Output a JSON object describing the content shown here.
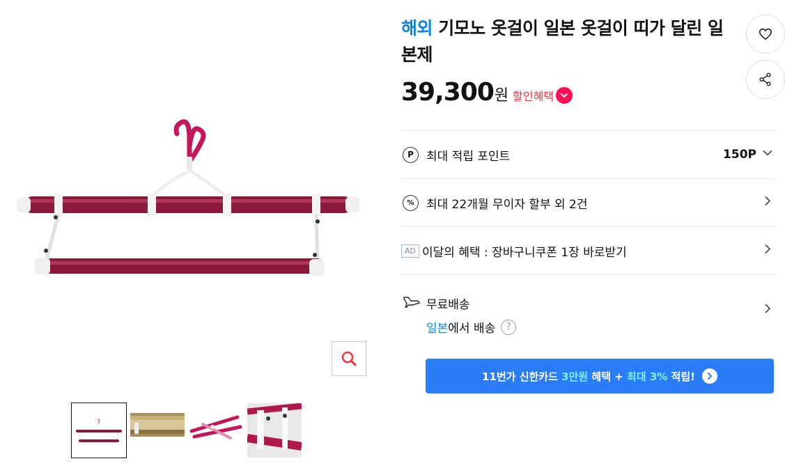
{
  "product": {
    "badge": "해외",
    "title": "기모노 옷걸이 일본 옷걸이 띠가 달린 일본제",
    "price": "39,300",
    "currency": "원",
    "discount_label": "할인혜택"
  },
  "actions": {
    "wish_icon": "heart-icon",
    "share_icon": "share-icon",
    "zoom_icon": "zoom-icon"
  },
  "benefits": {
    "points_label": "최대 적립 포인트",
    "points_value": "150P",
    "installment_label": "최대 22개월 무이자 할부 외 2건",
    "ad_tag": "AD",
    "ad_label": "이달의 혜택 : 장바구니쿠폰 1장 바로받기",
    "shipping_label": "무료배송",
    "ship_from_country": "일본",
    "ship_from_suffix": "에서 배송",
    "help_mark": "?"
  },
  "promo": {
    "part1": "11번가 신한카드 ",
    "part2": "3만원",
    "part3": " 혜택 + ",
    "part4": "최대 3%",
    "part5": " 적립!"
  },
  "image_mark": "?",
  "colors": {
    "brand_blue": "#0b83e6",
    "discount_red": "#f43142",
    "promo_blue": "#2a7cf7",
    "hanger_red": "#8b1a3a"
  }
}
